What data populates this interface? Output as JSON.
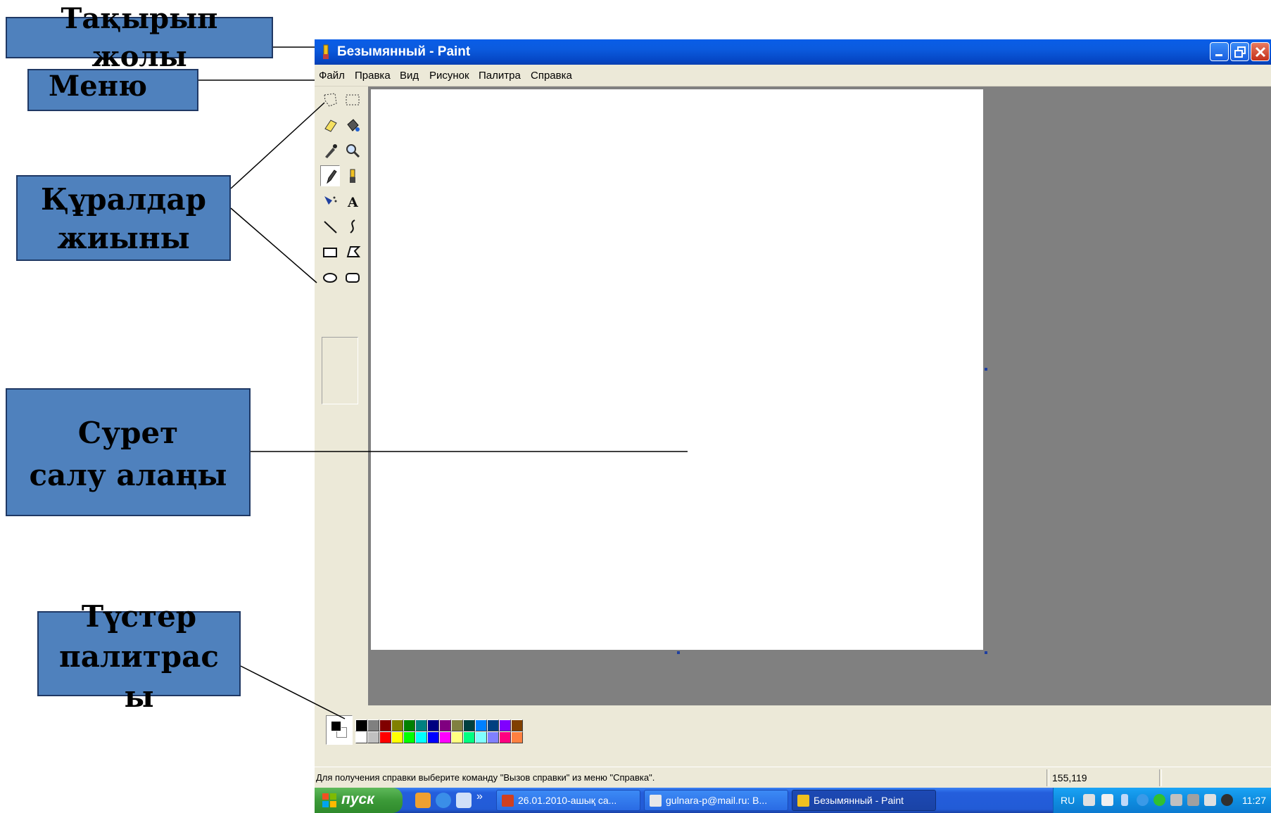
{
  "window": {
    "title": "Безымянный - Paint",
    "menu": [
      "Файл",
      "Правка",
      "Вид",
      "Рисунок",
      "Палитра",
      "Справка"
    ],
    "tools": [
      "free-form-select-icon",
      "select-icon",
      "eraser-icon",
      "fill-icon",
      "pick-color-icon",
      "magnifier-icon",
      "pencil-icon",
      "brush-icon",
      "airbrush-icon",
      "text-icon",
      "line-icon",
      "curve-icon",
      "rectangle-icon",
      "polygon-icon",
      "ellipse-icon",
      "rounded-rectangle-icon"
    ],
    "active_tool": "pencil-icon",
    "palette": {
      "foreground": "#000000",
      "background": "#ffffff",
      "top_row": [
        "#000000",
        "#808080",
        "#800000",
        "#808000",
        "#008000",
        "#008080",
        "#000080",
        "#800080",
        "#808040",
        "#004040",
        "#0080ff",
        "#004080",
        "#8000ff",
        "#804000"
      ],
      "bottom_row": [
        "#ffffff",
        "#c0c0c0",
        "#ff0000",
        "#ffff00",
        "#00ff00",
        "#00ffff",
        "#0000ff",
        "#ff00ff",
        "#ffff80",
        "#00ff80",
        "#80ffff",
        "#8080ff",
        "#ff0080",
        "#ff8040"
      ]
    },
    "status": {
      "help_text": "Для получения справки выберите команду \"Вызов справки\" из меню \"Справка\".",
      "coords": "155,119"
    }
  },
  "taskbar": {
    "start_label": "пуск",
    "chevron": "»",
    "tasks": [
      {
        "label": "26.01.2010-ашық са...",
        "icon": "powerpoint-icon"
      },
      {
        "label": "gulnara-p@mail.ru: В...",
        "icon": "browser-icon"
      },
      {
        "label": "Безымянный - Paint",
        "icon": "paint-icon"
      }
    ],
    "tray": {
      "lang": "RU",
      "clock": "11:27"
    }
  },
  "callouts": {
    "title_bar": [
      "Тақырып",
      "жолы"
    ],
    "menu": "Меню",
    "toolbox": [
      "Құралдар",
      "жиыны"
    ],
    "canvas": [
      "Сурет",
      "салу алаңы"
    ],
    "palette": [
      "Түстер",
      "палитрас",
      "ы"
    ]
  }
}
